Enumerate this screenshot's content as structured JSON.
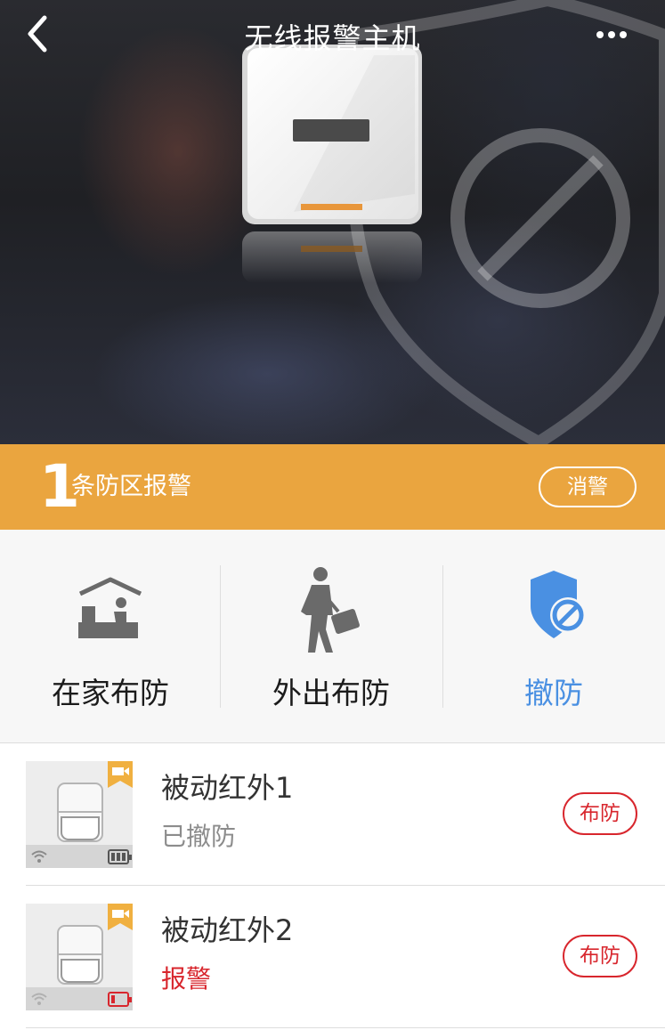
{
  "header": {
    "title": "无线报警主机",
    "back_icon": "chevron-left-icon",
    "more_icon": "more-horizontal-icon"
  },
  "alarm_bar": {
    "count": "1",
    "text": "条防区报警",
    "silence_label": "消警",
    "color": "#eaa53f"
  },
  "modes": [
    {
      "label": "在家布防",
      "icon": "home-arm-icon",
      "active": false
    },
    {
      "label": "外出布防",
      "icon": "away-arm-icon",
      "active": false
    },
    {
      "label": "撤防",
      "icon": "disarm-shield-icon",
      "active": true
    }
  ],
  "devices": [
    {
      "name": "被动红外1",
      "status": "已撤防",
      "action_label": "布防",
      "battery_low": false
    },
    {
      "name": "被动红外2",
      "status": "报警",
      "action_label": "布防",
      "battery_low": true
    }
  ],
  "colors": {
    "accent_blue": "#4a90e2",
    "alarm_red": "#d8262d",
    "banner_orange": "#eaa53f",
    "badge_orange": "#f0b040"
  }
}
